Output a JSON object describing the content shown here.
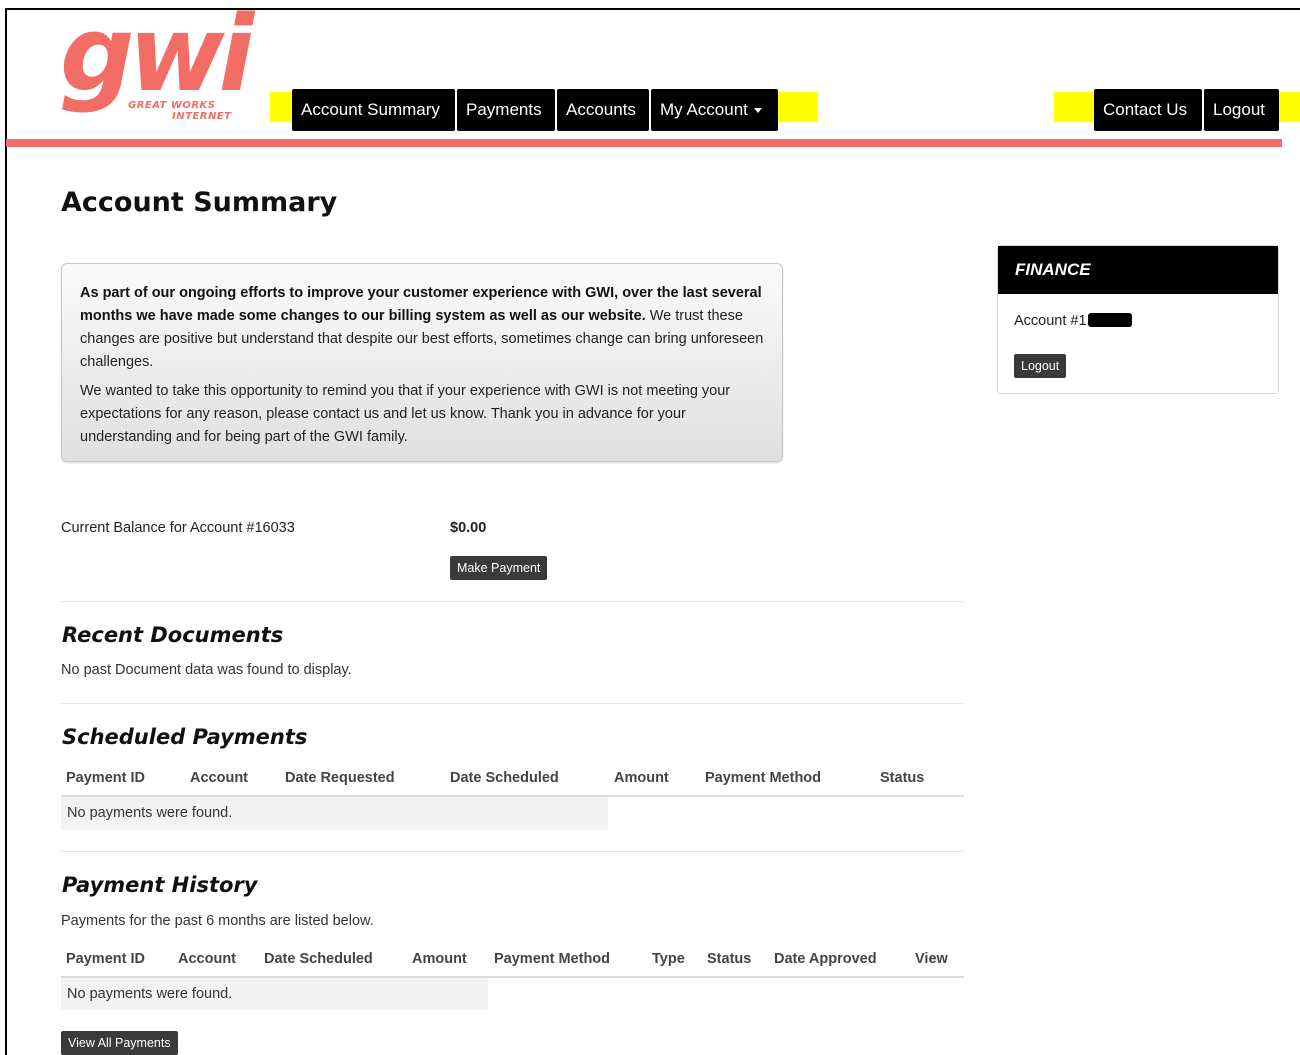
{
  "brand": {
    "logo_text": "gwi",
    "logo_line1": "GREAT WORKS",
    "logo_line2": "INTERNET",
    "accent_color": "#f26d66"
  },
  "nav": {
    "left": [
      {
        "label": "Account Summary"
      },
      {
        "label": "Payments"
      },
      {
        "label": "Accounts"
      },
      {
        "label": "My Account"
      }
    ],
    "right": [
      {
        "label": "Contact Us"
      },
      {
        "label": "Logout"
      }
    ]
  },
  "page": {
    "title": "Account Summary"
  },
  "notice": {
    "p1_bold": "As part of our ongoing efforts to improve your customer experience with GWI, over the last several months we have made some changes to our billing system as well as our website.",
    "p1_rest": " We trust these changes are positive but understand that despite our best efforts, sometimes change can bring unforeseen challenges.",
    "p2": "We wanted to take this opportunity to remind you that if your experience with GWI is not meeting your expectations for any reason, please contact us and let us know. Thank you in advance for your understanding and for being part of the GWI family."
  },
  "sidebar": {
    "heading": "FINANCE",
    "account_label": "Account #1",
    "logout_label": "Logout"
  },
  "balance": {
    "label": "Current Balance for Account #16033",
    "value": "$0.00",
    "make_payment_label": "Make Payment"
  },
  "recent_documents": {
    "heading": "Recent Documents",
    "empty_text": "No past Document data was found to display."
  },
  "scheduled_payments": {
    "heading": "Scheduled Payments",
    "columns": [
      "Payment ID",
      "Account",
      "Date Requested",
      "Date Scheduled",
      "Amount",
      "Payment Method",
      "Status"
    ],
    "empty_text": "No payments were found."
  },
  "payment_history": {
    "heading": "Payment History",
    "subtitle": "Payments for the past 6 months are listed below.",
    "columns": [
      "Payment ID",
      "Account",
      "Date Scheduled",
      "Amount",
      "Payment Method",
      "Type",
      "Status",
      "Date Approved",
      "View"
    ],
    "empty_text": "No payments were found.",
    "view_all_label": "View All Payments"
  }
}
